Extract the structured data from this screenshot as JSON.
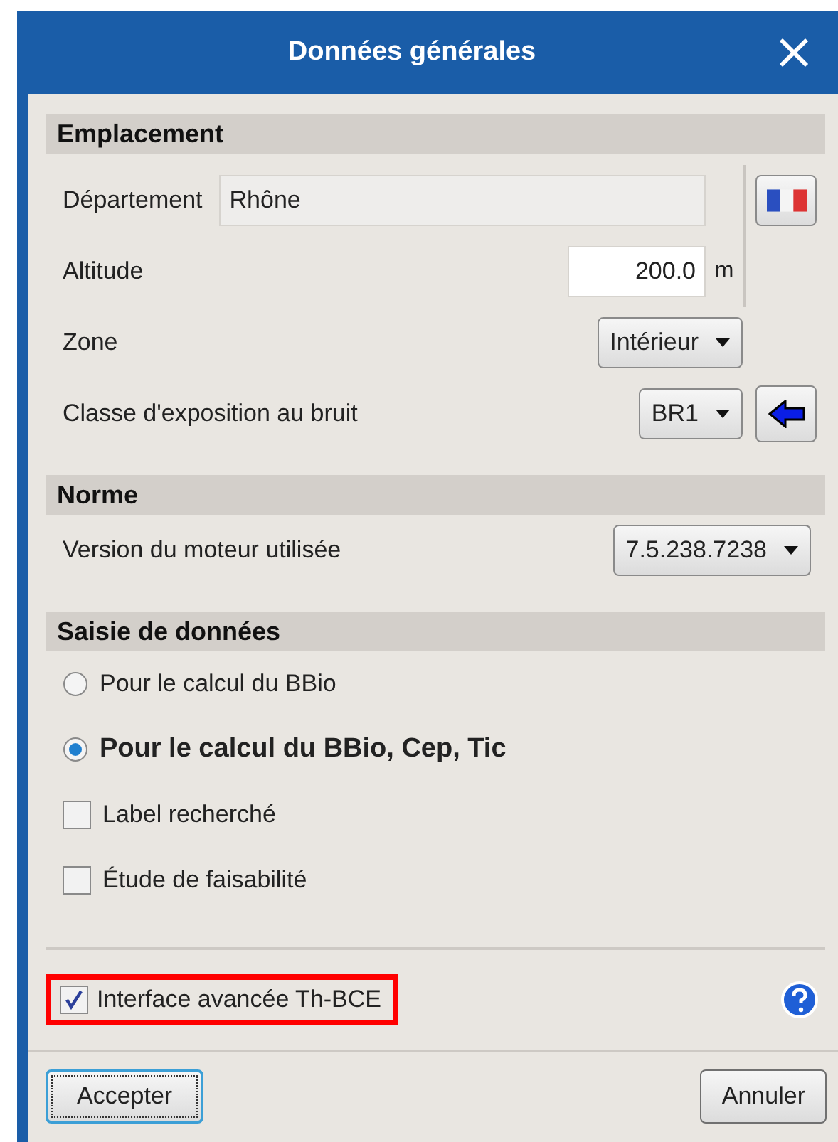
{
  "window": {
    "title": "Données générales"
  },
  "sections": [
    {
      "kind": "location",
      "title": "Emplacement",
      "rows": [
        {
          "kind": "text-field",
          "label": "Département",
          "value": "Rhône"
        },
        {
          "kind": "number-field",
          "label": "Altitude",
          "value": "200.0",
          "unit": "m"
        },
        {
          "kind": "dropdown",
          "label": "Zone",
          "value": "Intérieur"
        },
        {
          "kind": "dropdown-action",
          "label": "Classe d'exposition au bruit",
          "value": "BR1"
        }
      ]
    },
    {
      "kind": "plain",
      "title": "Norme",
      "rows": [
        {
          "kind": "dropdown",
          "label": "Version du moteur utilisée",
          "value": "7.5.238.7238"
        }
      ]
    },
    {
      "kind": "plain",
      "title": "Saisie de données",
      "rows": [
        {
          "kind": "radio",
          "label": "Pour le calcul du BBio",
          "selected": false
        },
        {
          "kind": "radio",
          "label": "Pour le calcul du BBio, Cep, Tic",
          "selected": true
        },
        {
          "kind": "checkbox",
          "label": "Label recherché",
          "checked": false
        },
        {
          "kind": "checkbox",
          "label": "Étude de faisabilité",
          "checked": false
        }
      ]
    }
  ],
  "advanced": {
    "label": "Interface avancée Th-BCE",
    "checked": true,
    "highlighted": true
  },
  "buttons": [
    {
      "label": "Accepter",
      "default": true
    },
    {
      "label": "Annuler",
      "default": false
    }
  ]
}
